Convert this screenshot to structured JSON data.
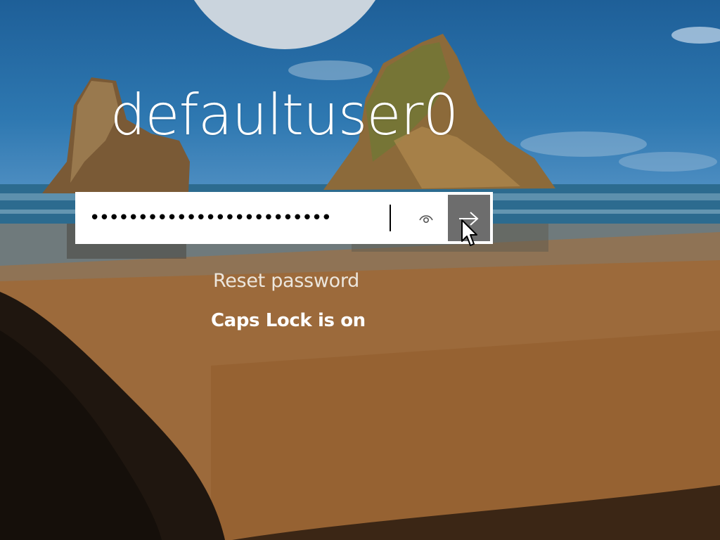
{
  "login": {
    "username": "defaultuser0",
    "password_mask": "•••••••••••••••••••••••••",
    "reveal_icon": "eye-icon",
    "submit_icon": "arrow-right-icon",
    "reset_password_link": "Reset password",
    "caps_lock_warning": "Caps Lock is on"
  },
  "colors": {
    "submit_bg": "#6d6d6d",
    "avatar_bg": "#cad4dd",
    "text": "#ffffff"
  }
}
